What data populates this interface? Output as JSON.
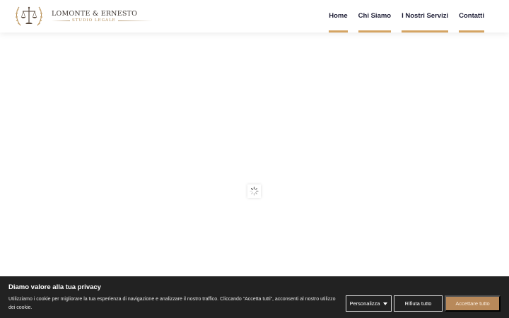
{
  "header": {
    "logo": {
      "name": "LOMONTE & ERNESTO",
      "subtitle": "STUDIO LEGALE"
    },
    "nav": [
      {
        "label": "Home"
      },
      {
        "label": "Chi Siamo"
      },
      {
        "label": "I Nostri Servizi"
      },
      {
        "label": "Contatti"
      }
    ]
  },
  "cookie_banner": {
    "title": "Diamo valore alla tua privacy",
    "text": "Utilizziamo i cookie per migliorare la tua esperienza di navigazione e analizzare il nostro traffico. Cliccando “Accetta tutti”, acconsenti al nostro utilizzo dei cookie.",
    "customize_label": "Personalizza",
    "reject_label": "Rifiuta tutto",
    "accept_label": "Accettare tutto"
  },
  "colors": {
    "accent": "#d4a463",
    "accept_button": "#b8895a",
    "banner_bg": "#222222",
    "nav_text": "#1c1c34"
  },
  "icons": {
    "logo_emblem": "scales-of-justice-laurel-icon",
    "loader": "spinner-icon",
    "dropdown": "caret-down-icon"
  }
}
